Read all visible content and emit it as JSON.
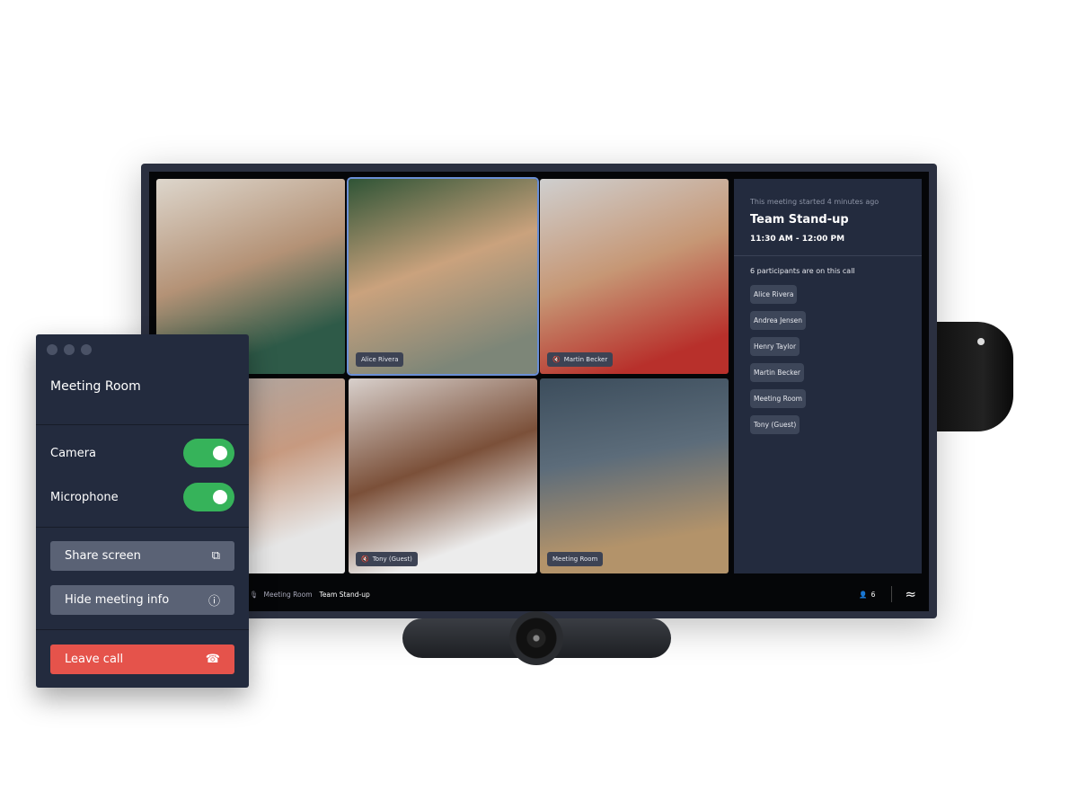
{
  "tiles": [
    {
      "name": "",
      "bg": "linear-gradient(160deg,#ddd6cc,#b49276 45%,#2e5a48 80%)"
    },
    {
      "name": "Alice Rivera",
      "muted": false,
      "active": true,
      "bg": "linear-gradient(160deg,#2f5436,#caa27d 45%,#7d8678 85%)"
    },
    {
      "name": "Martin Becker",
      "muted": true,
      "bg": "linear-gradient(160deg,#cfcfcf,#c69775 45%,#b8302b 85%)"
    },
    {
      "name": "",
      "bg": "linear-gradient(160deg,#a9a9a9,#c79a80 45%,#e6e6e6 80%)"
    },
    {
      "name": "Tony (Guest)",
      "muted": true,
      "bg": "linear-gradient(160deg,#d8d0cc,#7b5039 45%,#ececec 80%)"
    },
    {
      "name": "Meeting Room",
      "muted": false,
      "bg": "linear-gradient(170deg,#3c4d5c,#5c6c7a 40%,#b3936a 80%)"
    }
  ],
  "sidebar": {
    "started": "This meeting started 4 minutes ago",
    "title": "Team Stand-up",
    "time": "11:30 AM - 12:00 PM",
    "count": "6 participants are on this call",
    "participants": [
      "Alice Rivera",
      "Andrea Jensen",
      "Henry Taylor",
      "Martin Becker",
      "Meeting Room",
      "Tony (Guest)"
    ]
  },
  "bottombar": {
    "room": "Meeting Room",
    "meeting": "Team Stand-up",
    "participants": "6"
  },
  "panel": {
    "title": "Meeting Room",
    "camera_label": "Camera",
    "camera_on": true,
    "mic_label": "Microphone",
    "mic_on": true,
    "share": "Share screen",
    "hide": "Hide meeting info",
    "leave": "Leave call"
  },
  "colors": {
    "accent_green": "#36b35a",
    "leave_red": "#e5534b",
    "panel_bg": "#232b3e"
  }
}
